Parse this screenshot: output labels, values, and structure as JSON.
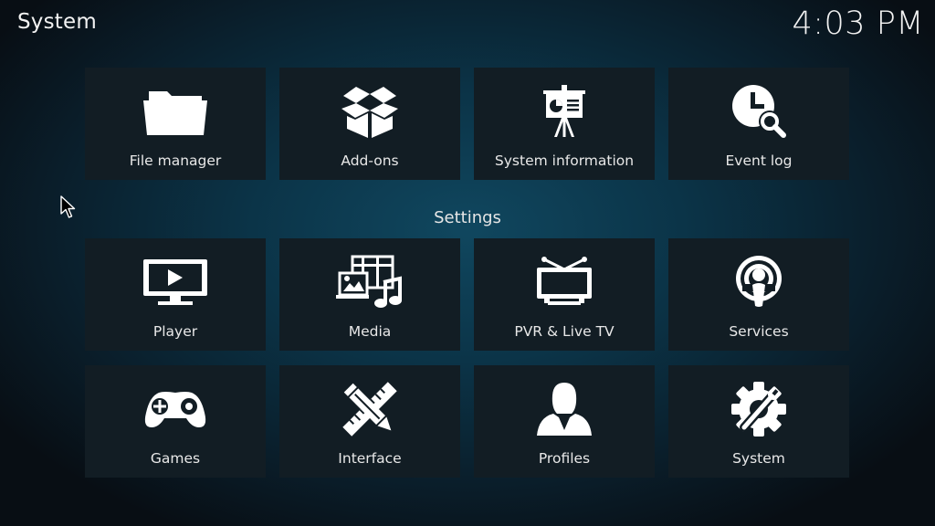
{
  "header": {
    "title": "System",
    "clock": "4:03 PM"
  },
  "top_row": [
    {
      "label": "File manager",
      "icon": "folder-icon"
    },
    {
      "label": "Add-ons",
      "icon": "open-box-icon"
    },
    {
      "label": "System information",
      "icon": "presentation-easel-icon"
    },
    {
      "label": "Event log",
      "icon": "clock-search-icon"
    }
  ],
  "settings": {
    "heading": "Settings",
    "row1": [
      {
        "label": "Player",
        "icon": "monitor-play-icon"
      },
      {
        "label": "Media",
        "icon": "media-icon"
      },
      {
        "label": "PVR & Live TV",
        "icon": "tv-antenna-icon"
      },
      {
        "label": "Services",
        "icon": "podcast-icon"
      }
    ],
    "row2": [
      {
        "label": "Games",
        "icon": "gamepad-icon"
      },
      {
        "label": "Interface",
        "icon": "pencil-ruler-icon"
      },
      {
        "label": "Profiles",
        "icon": "user-profile-icon"
      },
      {
        "label": "System",
        "icon": "gear-wrench-icon"
      }
    ]
  }
}
